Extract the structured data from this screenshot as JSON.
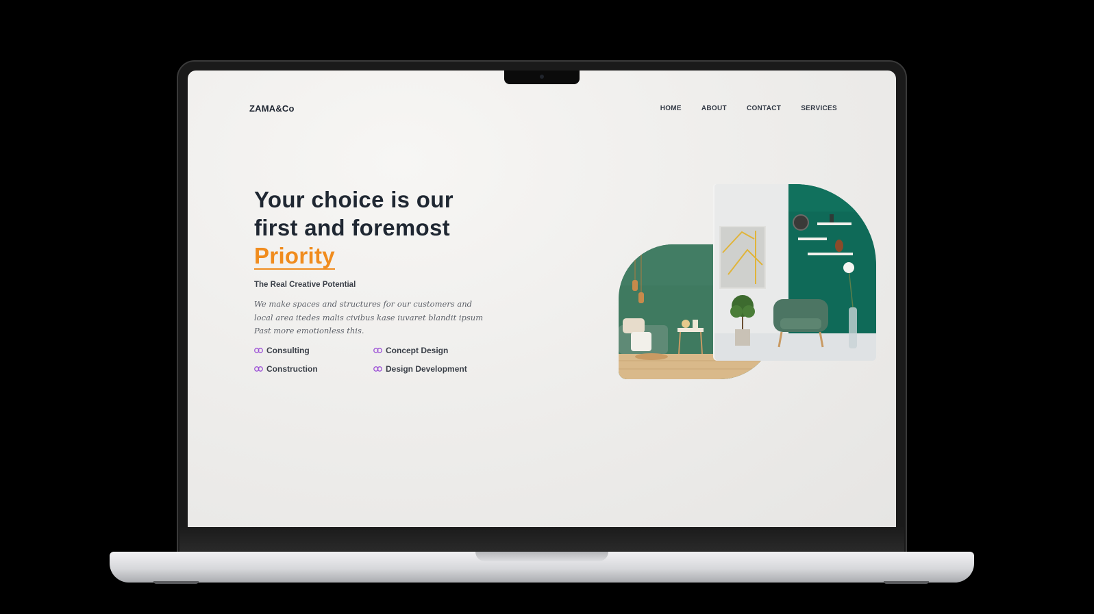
{
  "brand": {
    "logo": "ZAMA&Co"
  },
  "nav": {
    "items": [
      {
        "label": "HOME"
      },
      {
        "label": "ABOUT"
      },
      {
        "label": "CONTACT"
      },
      {
        "label": "SERVICES"
      }
    ]
  },
  "hero": {
    "title_line1": "Your choice is our",
    "title_line2": "first and foremost",
    "title_accent": "Priority",
    "subtitle": "The Real Creative Potential",
    "description": "We make spaces and structures for our customers and local area itedes malis civibus kase iuvaret blandit ipsum Past more emotionless this."
  },
  "services": [
    {
      "label": "Consulting",
      "icon": "link-icon"
    },
    {
      "label": "Concept Design",
      "icon": "link-icon"
    },
    {
      "label": "Construction",
      "icon": "link-icon"
    },
    {
      "label": "Design Development",
      "icon": "link-icon"
    }
  ],
  "colors": {
    "accent": "#f08c1e",
    "heading": "#1f2732",
    "icon": "#9b4fd6",
    "room_green": "#3f7a60",
    "wall_teal": "#0f6a58"
  }
}
